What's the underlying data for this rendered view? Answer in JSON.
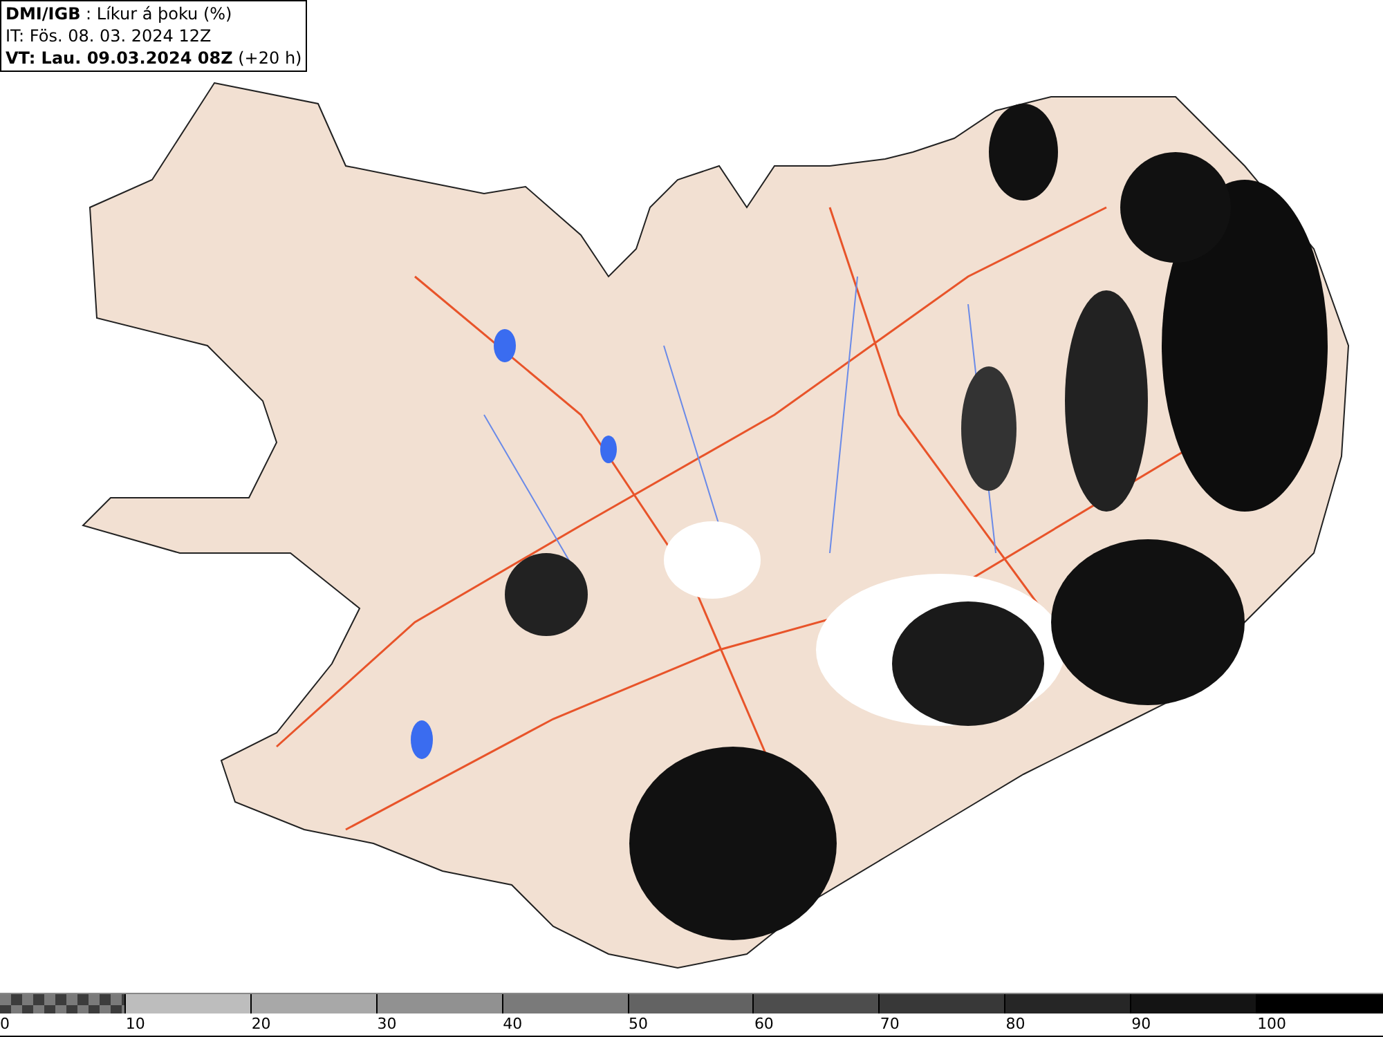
{
  "header": {
    "lines": [
      "**DMI/IGB** : Líkur á þoku (%)",
      "IT: Fös. 08. 03. 2024 12Z",
      "**VT: Lau. 09.03.2024 08Z** (+20 h)"
    ]
  },
  "legend": {
    "segments": [
      {
        "kind": "checker",
        "color": "#7a7a7a",
        "label": "0"
      },
      {
        "kind": "solid",
        "color": "#bdbdbd",
        "label": "10"
      },
      {
        "kind": "solid",
        "color": "#a8a8a8",
        "label": "20"
      },
      {
        "kind": "solid",
        "color": "#919191",
        "label": "30"
      },
      {
        "kind": "solid",
        "color": "#7a7a7a",
        "label": "40"
      },
      {
        "kind": "solid",
        "color": "#636363",
        "label": "50"
      },
      {
        "kind": "solid",
        "color": "#4d4d4d",
        "label": "60"
      },
      {
        "kind": "solid",
        "color": "#383838",
        "label": "70"
      },
      {
        "kind": "solid",
        "color": "#262626",
        "label": "80"
      },
      {
        "kind": "solid",
        "color": "#141414",
        "label": "90"
      },
      {
        "kind": "solid",
        "color": "#000000",
        "label": "100"
      }
    ]
  }
}
